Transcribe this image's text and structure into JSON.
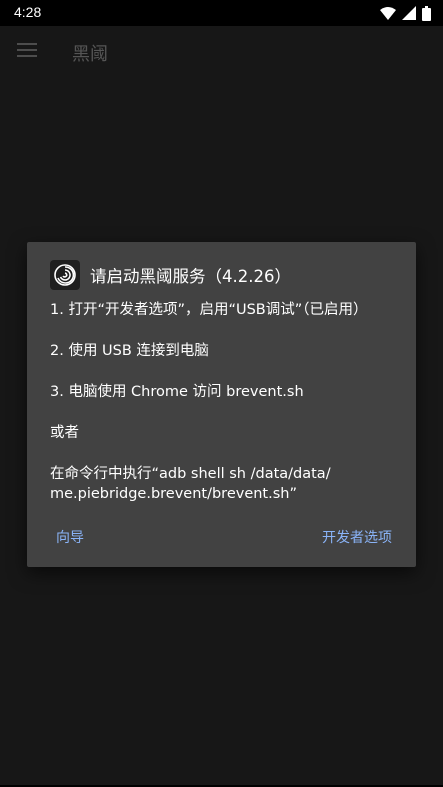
{
  "status_bar": {
    "time": "4:28"
  },
  "app_bar": {
    "title": "黑阈"
  },
  "dialog": {
    "title": "请启动黑阈服务（4.2.26）",
    "steps": [
      "1. 打开“开发者选项”，启用“USB调试”（已启用）",
      "2. 使用 USB 连接到电脑",
      "3. 电脑使用 Chrome 访问 brevent.sh",
      "或者",
      "在命令行中执行“adb shell sh /data/data/",
      "me.piebridge.brevent/brevent.sh”"
    ],
    "buttons": {
      "guide": "向导",
      "developer_options": "开发者选项"
    }
  },
  "colors": {
    "background": "#171717",
    "dialog": "#424242",
    "accent": "#8ab4f8"
  },
  "icons": {
    "menu": "menu-icon",
    "app": "brevent-app-icon",
    "wifi": "wifi-icon",
    "signal": "signal-icon",
    "battery": "battery-icon"
  }
}
